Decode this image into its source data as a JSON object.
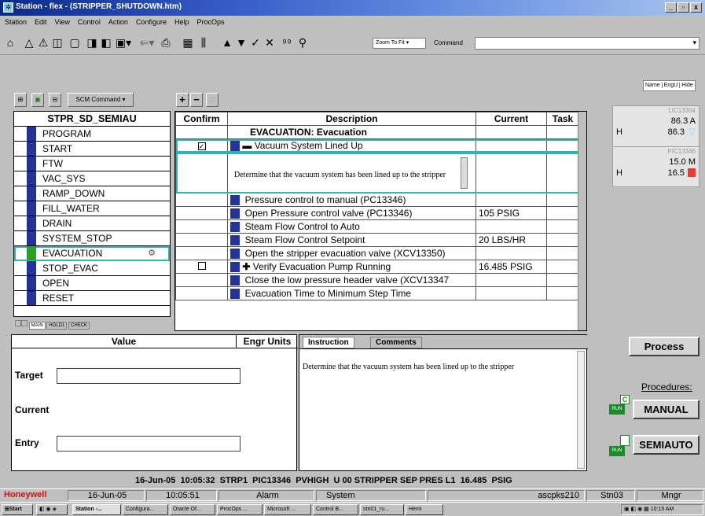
{
  "window": {
    "title": "Station - flex - (STRIPPER_SHUTDOWN.htm)",
    "min": "_",
    "max": "▫",
    "close": "x"
  },
  "menu": [
    "Station",
    "Edit",
    "View",
    "Control",
    "Action",
    "Configure",
    "Help",
    "ProcOps"
  ],
  "toolbar": {
    "zoom": "Zoom To Fit",
    "command_label": "Command",
    "command_value": ""
  },
  "right_header": {
    "buttons": [
      "Name",
      "EngU",
      "Hide"
    ]
  },
  "sfc": {
    "command_button": "SCM Command",
    "add": "+",
    "remove": "−"
  },
  "steps": {
    "header": "STPR_SD_SEMIAU",
    "items": [
      "PROGRAM",
      "START",
      "FTW",
      "VAC_SYS",
      "RAMP_DOWN",
      "FILL_WATER",
      "DRAIN",
      "SYSTEM_STOP",
      "EVACUATION",
      "STOP_EVAC",
      "OPEN",
      "RESET"
    ],
    "selected_index": 8,
    "tabs": [
      "MAIN",
      "HOLD1",
      "CHECK"
    ]
  },
  "grid": {
    "headers": [
      "Confirm",
      "Description",
      "Current",
      "Task"
    ],
    "title_row": "EVACUATION: Evacuation",
    "vac_row": "Vacuum System Lined Up",
    "note": "Determine that the vacuum system has been lined up to the stripper",
    "rows": [
      {
        "desc": "Pressure control to manual (PC13346)",
        "current": ""
      },
      {
        "desc": "Open Pressure control valve (PC13346)",
        "current": "105 PSIG"
      },
      {
        "desc": "Steam Flow Control to Auto",
        "current": ""
      },
      {
        "desc": "Steam Flow Control Setpoint",
        "current": "20 LBS/HR"
      },
      {
        "desc": "Open the stripper evacuation valve (XCV13350)",
        "current": ""
      },
      {
        "desc": "Verify Evacuation Pump Running",
        "current": "16.485 PSIG"
      },
      {
        "desc": "Close the low pressure header valve (XCV13347",
        "current": ""
      },
      {
        "desc": "Evacuation Time to Minimum Step Time",
        "current": ""
      }
    ]
  },
  "faceplates": [
    {
      "tag": "LIC13304",
      "pv": "86.3 A",
      "h_label": "H",
      "h_value": "86.3"
    },
    {
      "tag": "PIC13346",
      "pv": "15.0 M",
      "h_label": "H",
      "h_value": "16.5"
    }
  ],
  "values_panel": {
    "value_header": "Value",
    "units_header": "Engr Units",
    "target": "Target",
    "current": "Current",
    "entry": "Entry",
    "instruction_tab": "Instruction",
    "comments_tab": "Comments",
    "instruction_text": "Determine that the vacuum system has been lined up to the stripper"
  },
  "side_controls": {
    "process": "Process",
    "procedures": "Procedures:",
    "manual": "MANUAL",
    "semiauto": "SEMIAUTO",
    "run": "RUN",
    "c_badge": "C"
  },
  "alarm_line": "16-Jun-05  10:05:32  STRP1  PIC13346  PVHIGH  U 00 STRIPPER SEP PRES L1  16.485  PSIG",
  "status": {
    "brand": "Honeywell",
    "date": "16-Jun-05",
    "time": "10:05:51",
    "alarm": "Alarm",
    "system": "System",
    "node": "ascpks210",
    "station": "Stn03",
    "mode": "Mngr"
  },
  "taskbar": {
    "start": "Start",
    "tasks": [
      "Station -...",
      "Configura...",
      "Oracle Of...",
      "ProcOps ...",
      "Microsoft ...",
      "Control B...",
      "stn01_ru...",
      "Hemi"
    ],
    "clock": "10:15 AM"
  }
}
